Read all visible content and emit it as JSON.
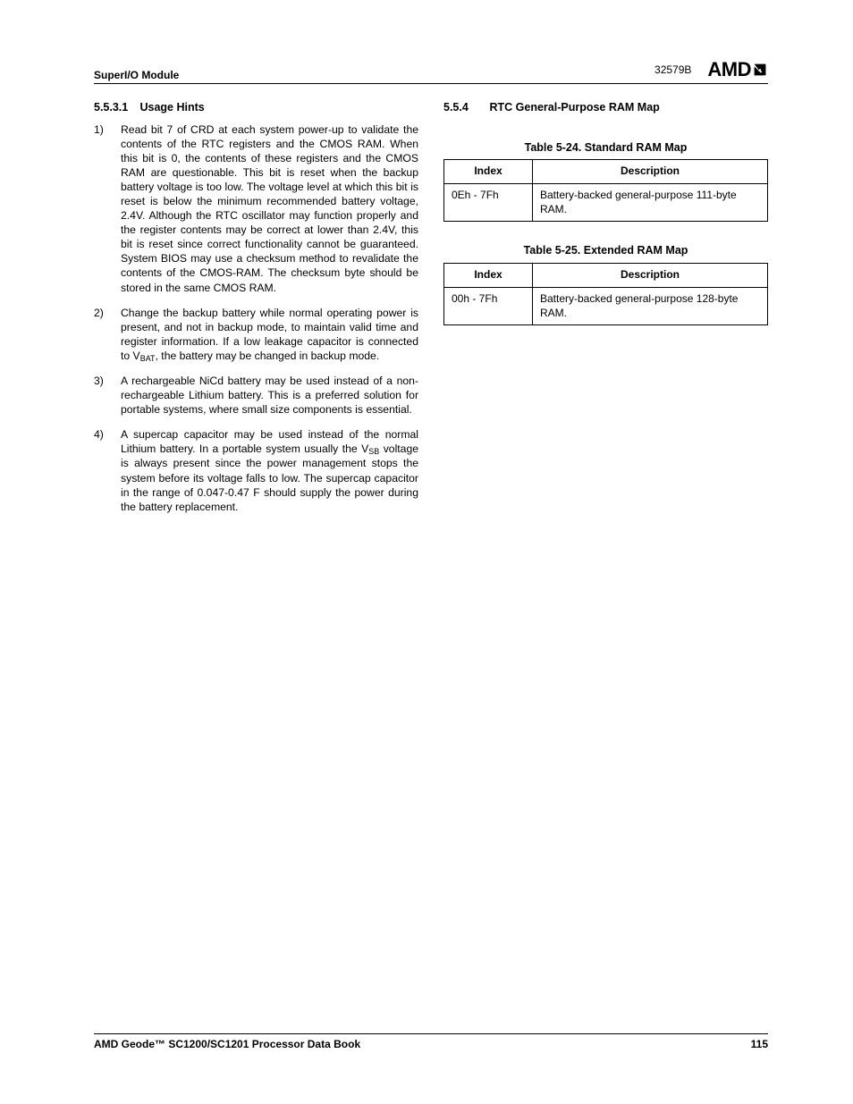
{
  "header": {
    "module": "SuperI/O Module",
    "doc_code": "32579B",
    "logo_text": "AMD"
  },
  "leftCol": {
    "sec_num": "5.5.3.1",
    "sec_title": "Usage Hints",
    "items": [
      {
        "marker": "1)",
        "html": "Read bit 7 of CRD at each system power-up to validate the contents of the RTC registers and the CMOS RAM. When this bit is 0, the contents of these registers and the CMOS RAM are questionable. This bit is reset when the backup battery voltage is too low. The voltage level at which this bit is reset is below the minimum recommended battery voltage, 2.4V. Although the RTC oscillator may function properly and the register contents may be correct at lower than 2.4V, this bit is reset since correct functionality cannot be guaranteed. System BIOS may use a checksum method to revalidate the contents of the CMOS-RAM. The checksum byte should be stored in the same CMOS RAM."
      },
      {
        "marker": "2)",
        "html": "Change the backup battery while normal operating power is present, and not in backup mode, to maintain valid time and register information. If a low leakage capacitor is connected to V<sub>BAT</sub>, the battery may be changed in backup mode."
      },
      {
        "marker": "3)",
        "html": "A rechargeable NiCd battery may be used instead of a non-rechargeable Lithium battery. This is a preferred solution for portable systems, where small size components is essential."
      },
      {
        "marker": "4)",
        "html": "A supercap capacitor may be used instead of the normal Lithium battery. In a portable system usually the V<sub>SB</sub> voltage is always present since the power management stops the system before its voltage falls to low. The supercap capacitor in the range of 0.047-0.47 F should supply the power during the battery replacement."
      }
    ]
  },
  "rightCol": {
    "sec_num": "5.5.4",
    "sec_title": "RTC General-Purpose RAM Map",
    "tables": [
      {
        "caption": "Table 5-24.  Standard RAM Map",
        "headers": [
          "Index",
          "Description"
        ],
        "rows": [
          [
            "0Eh - 7Fh",
            "Battery-backed general-purpose 111-byte RAM."
          ]
        ]
      },
      {
        "caption": "Table 5-25.  Extended RAM Map",
        "headers": [
          "Index",
          "Description"
        ],
        "rows": [
          [
            "00h - 7Fh",
            "Battery-backed general-purpose 128-byte RAM."
          ]
        ]
      }
    ]
  },
  "footer": {
    "book_title": "AMD Geode™ SC1200/SC1201 Processor Data Book",
    "page_num": "115"
  }
}
